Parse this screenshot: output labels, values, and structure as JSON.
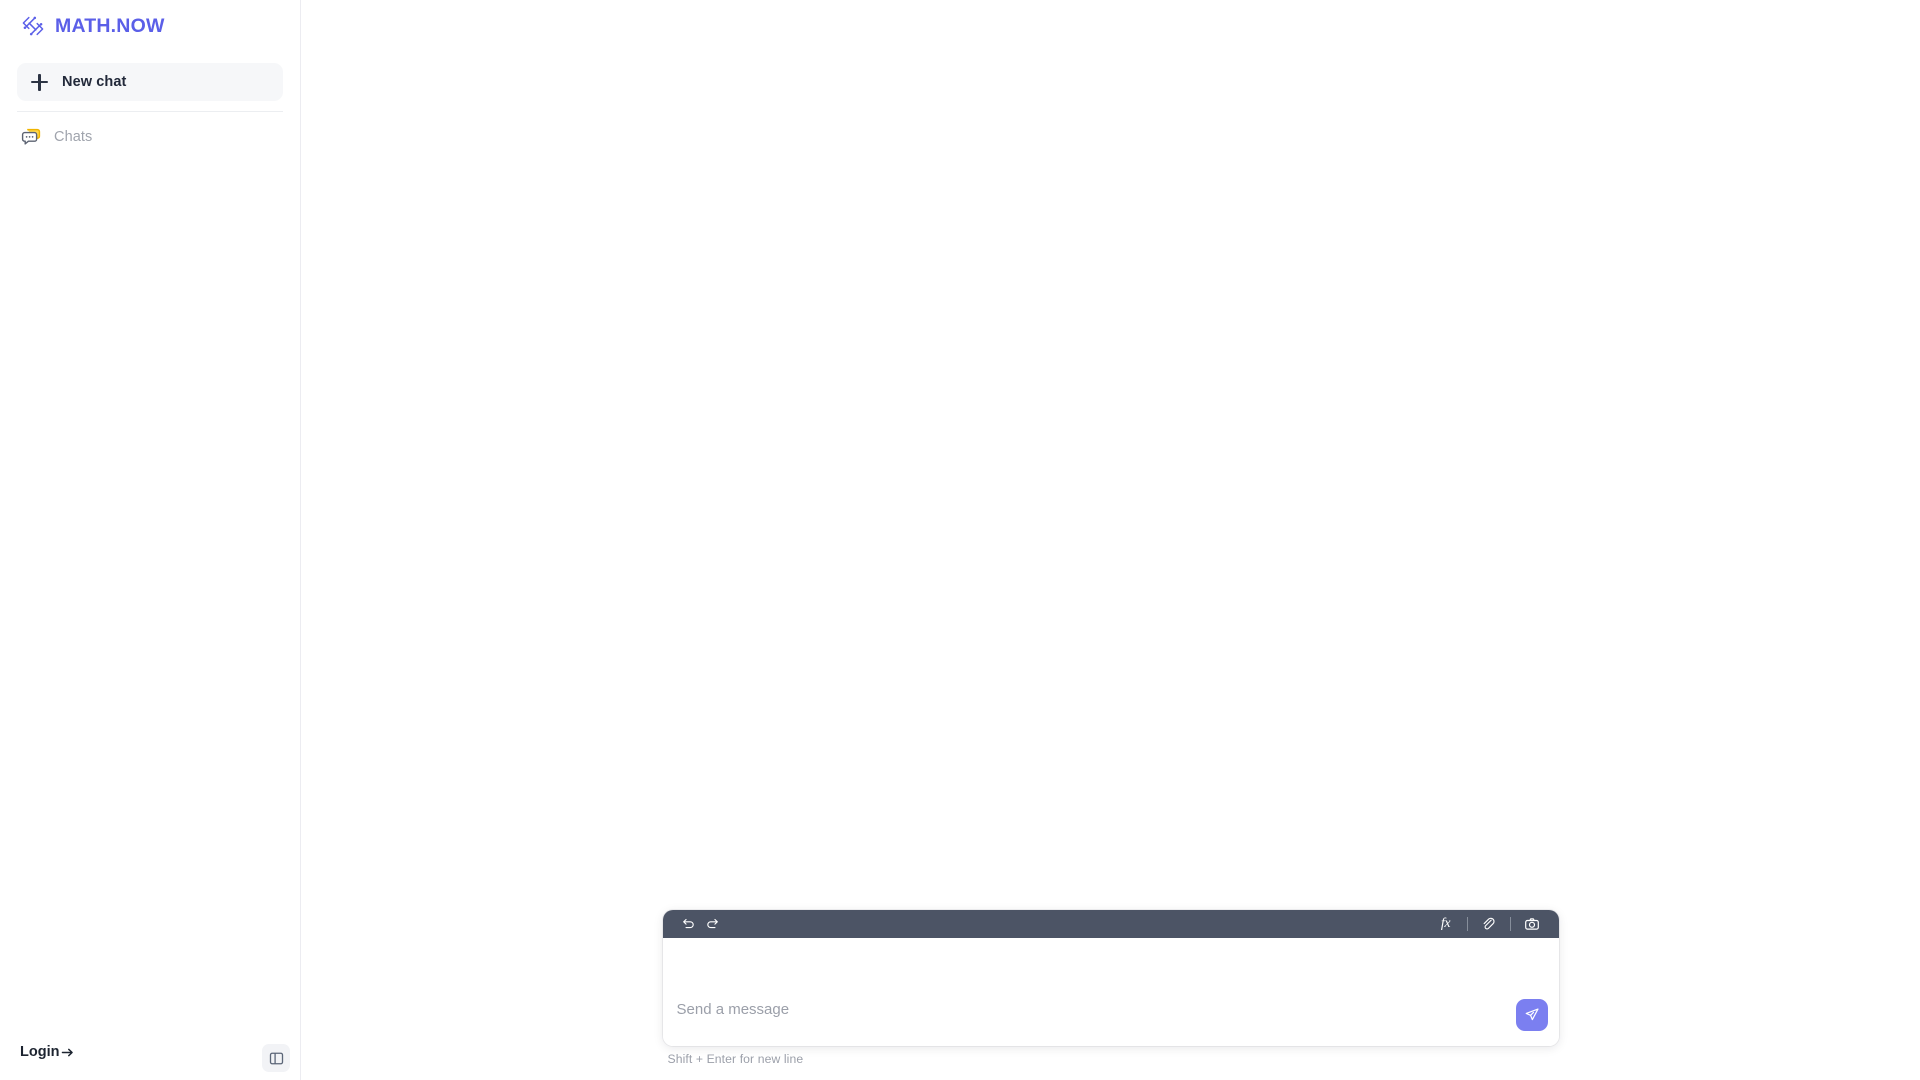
{
  "brand": {
    "name": "MATH.NOW",
    "logo_icon": "math-now-logo-icon",
    "accent_color": "#5b5fe8"
  },
  "sidebar": {
    "new_chat": {
      "label": "New chat",
      "icon": "plus-icon"
    },
    "items": [
      {
        "label": "Chats",
        "icon": "chat-bubble-icon",
        "icon_color": "#f5c518"
      }
    ],
    "login": {
      "label": "Login",
      "icon": "arrow-right-icon"
    },
    "toggle": {
      "icon": "sidebar-panel-icon"
    }
  },
  "composer": {
    "toolbar": {
      "undo": {
        "label": "Undo",
        "icon": "undo-icon"
      },
      "redo": {
        "label": "Redo",
        "icon": "redo-icon"
      },
      "math": {
        "label": "fx",
        "icon": "function-fx-icon"
      },
      "attach": {
        "label": "Attach",
        "icon": "paperclip-icon"
      },
      "camera": {
        "label": "Camera",
        "icon": "camera-icon"
      }
    },
    "input": {
      "placeholder": "Send a message",
      "value": ""
    },
    "send": {
      "icon": "send-paper-plane-icon",
      "color": "#7b7ff0"
    },
    "hint": "Shift + Enter for new line"
  },
  "colors": {
    "toolbar_bg": "#4c5465",
    "sidebar_border": "#ececf1",
    "new_chat_bg": "#f6f7f9",
    "muted_text": "#9b9fa9"
  }
}
